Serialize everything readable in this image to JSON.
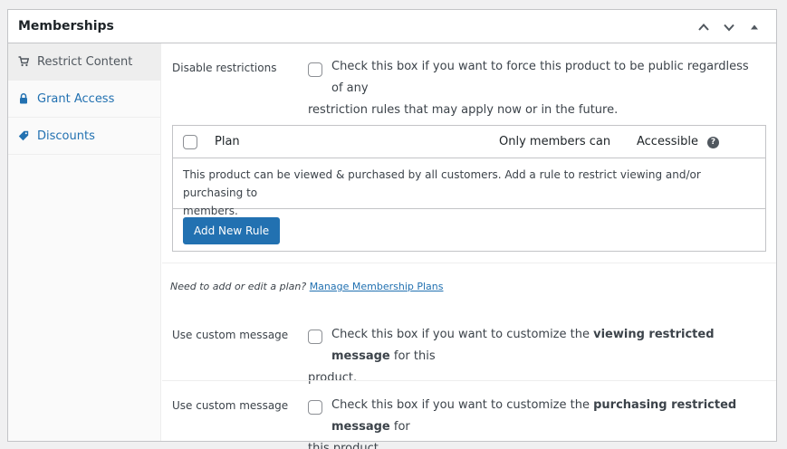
{
  "metabox": {
    "title": "Memberships"
  },
  "header_icons": [
    "chevron-up-icon",
    "chevron-down-icon",
    "collapse-arrow-icon"
  ],
  "sidebar": {
    "items": [
      {
        "label": "Restrict Content",
        "icon": "cart-icon",
        "active": true
      },
      {
        "label": "Grant Access",
        "icon": "lock-icon",
        "active": false
      },
      {
        "label": "Discounts",
        "icon": "tag-icon",
        "active": false
      }
    ]
  },
  "disable_restrictions": {
    "label": "Disable restrictions",
    "line1": "Check this box if you want to force this product to be public regardless of any",
    "line2": "restriction rules that may apply now or in the future."
  },
  "rules_table": {
    "columns": {
      "plan": "Plan",
      "only_members": "Only members can",
      "accessible": "Accessible"
    },
    "empty_line1": "This product can be viewed & purchased by all customers. Add a rule to restrict viewing and/or purchasing to",
    "empty_line2": "members.",
    "add_button": "Add New Rule"
  },
  "plan_note": {
    "text": "Need to add or edit a plan?",
    "link": "Manage Membership Plans"
  },
  "custom_view": {
    "label": "Use custom message",
    "pre": "Check this box if you want to customize the",
    "bold": "viewing restricted message",
    "post": "for this",
    "line2": "product."
  },
  "custom_purchase": {
    "label": "Use custom message",
    "pre": "Check this box if you want to customize the",
    "bold": "purchasing restricted message",
    "post": "for",
    "line2": "this product."
  },
  "colors": {
    "accent": "#2271b1",
    "border": "#c3c4c7",
    "text": "#3c434a"
  }
}
